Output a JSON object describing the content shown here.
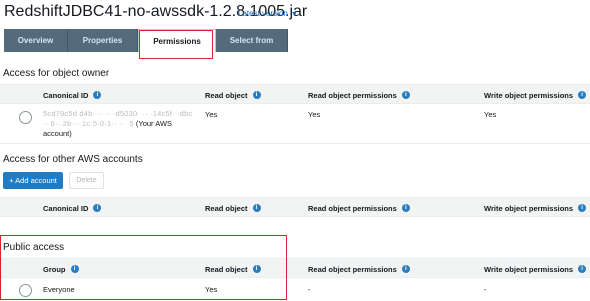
{
  "header": {
    "title": "RedshiftJDBC41-no-awssdk-1.2.8.1005.jar",
    "version_label": "Latest version",
    "version_caret": "▼"
  },
  "tabs": [
    {
      "label": "Overview"
    },
    {
      "label": "Properties"
    },
    {
      "label": "Permissions"
    },
    {
      "label": "Select from"
    }
  ],
  "owner": {
    "title": "Access for object owner",
    "columns": {
      "canonical_id": "Canonical ID",
      "read_object": "Read object",
      "read_permissions": "Read object permissions",
      "write_permissions": "Write object permissions"
    },
    "row": {
      "canonical_id_blurred_1": "5cd79c5d d4b· ·· ·· ·d5030· ·· ·14c5f· ·dbc",
      "canonical_id_blurred_2": "·· 6·· 2b··· 1c·5·0·1·· ·· ·5",
      "canonical_id_suffix": "(Your AWS",
      "canonical_id_line3": "account)",
      "read_object": "Yes",
      "read_permissions": "Yes",
      "write_permissions": "Yes"
    }
  },
  "accounts": {
    "title": "Access for other AWS accounts",
    "add_button": "+ Add account",
    "delete_button": "Delete",
    "columns": {
      "canonical_id": "Canonical ID",
      "read_object": "Read object",
      "read_permissions": "Read object permissions",
      "write_permissions": "Write object permissions"
    }
  },
  "public": {
    "title": "Public access",
    "columns": {
      "group": "Group",
      "read_object": "Read object",
      "read_permissions": "Read object permissions",
      "write_permissions": "Write object permissions"
    },
    "row": {
      "group": "Everyone",
      "read_object": "Yes",
      "read_permissions": "-",
      "write_permissions": "-"
    }
  },
  "colors": {
    "tab_bg": "#546b7d",
    "accent": "#1f7bc3",
    "highlight": "#d9262e"
  }
}
